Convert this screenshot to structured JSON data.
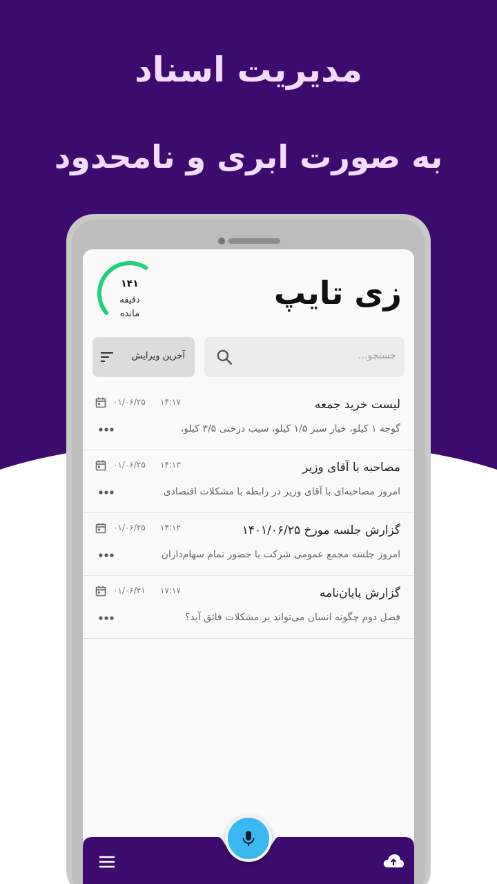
{
  "colors": {
    "hero_bg": "#3d0a6e",
    "headline_text": "#f4dcff",
    "bottom_bar": "#3d0a6e",
    "gauge": "#1fd17a",
    "fab": "#3ab8f0"
  },
  "hero": {
    "line1": "مدیریت اسناد",
    "line2": "به صورت ابری و نامحدود"
  },
  "app": {
    "logo": "زی تایپ",
    "credits": {
      "value": "۱۴۱",
      "label1": "دقیقه",
      "label2": "مانده",
      "fraction_remaining": 0.45
    },
    "search": {
      "placeholder": "جستجو..."
    },
    "sort": {
      "label": "آخرین ویرایش"
    },
    "notes": [
      {
        "title": "لیست خرید جمعه",
        "snippet": "گوجه ۱ کیلو، خیار سبز ۱/۵ کیلو، سیب درختی ۳/۵ کیلو،",
        "time": "۱۴:۱۷",
        "date": "۰۱/۰۶/۲۵"
      },
      {
        "title": "مصاحبه با آقای وزیر",
        "snippet": "امروز مصاحبه‌ای با آقای وزیر در رابطه با مشکلات اقتصادی",
        "time": "۱۴:۱۳",
        "date": "۰۱/۰۶/۲۵"
      },
      {
        "title": "گزارش جلسه مورخ ۱۴۰۱/۰۶/۲۵",
        "snippet": "امروز جلسه مجمع عمومی شرکت با حضور تمام سهام‌داران",
        "time": "۱۴:۱۲",
        "date": "۰۱/۰۶/۲۵"
      },
      {
        "title": "گزارش پایان‌نامه",
        "snippet": "فصل دوم چگونه انسان می‌تواند بر مشکلات فائق آید؟",
        "time": "۱۷:۱۷",
        "date": "۰۱/۰۶/۲۱"
      }
    ],
    "icons": {
      "menu": "menu-icon",
      "cloud": "cloud-upload-icon",
      "mic": "mic-icon",
      "search": "search-icon",
      "sort": "sort-icon",
      "calendar": "calendar-icon",
      "more": "more-horizontal-icon"
    }
  }
}
